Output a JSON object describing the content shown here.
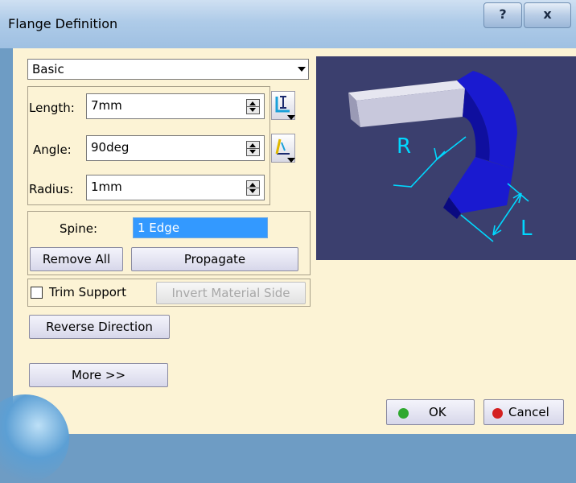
{
  "window": {
    "title": "Flange Definition",
    "help_label": "?",
    "close_label": "x"
  },
  "mode": {
    "selected": "Basic"
  },
  "parameters": {
    "length": {
      "label": "Length:",
      "value": "7mm",
      "icon": "length-type-icon"
    },
    "angle": {
      "label": "Angle:",
      "value": "90deg",
      "icon": "angle-type-icon"
    },
    "radius": {
      "label": "Radius:",
      "value": "1mm"
    }
  },
  "spine": {
    "label": "Spine:",
    "value": "1 Edge",
    "remove_all_label": "Remove All",
    "propagate_label": "Propagate"
  },
  "options": {
    "trim_support_label": "Trim Support",
    "trim_support_checked": false,
    "invert_material_side_label": "Invert Material Side",
    "invert_material_side_enabled": false,
    "reverse_direction_label": "Reverse Direction",
    "more_label": "More >>"
  },
  "preview": {
    "radius_label": "R",
    "length_label": "L",
    "colors": {
      "background": "#3b3f6e",
      "flange": "#1a1ad0",
      "base": "#c8c8dc",
      "dimension": "#00d8ff"
    }
  },
  "footer": {
    "ok_label": "OK",
    "cancel_label": "Cancel",
    "ok_color": "#2ea82e",
    "cancel_color": "#d42020"
  }
}
